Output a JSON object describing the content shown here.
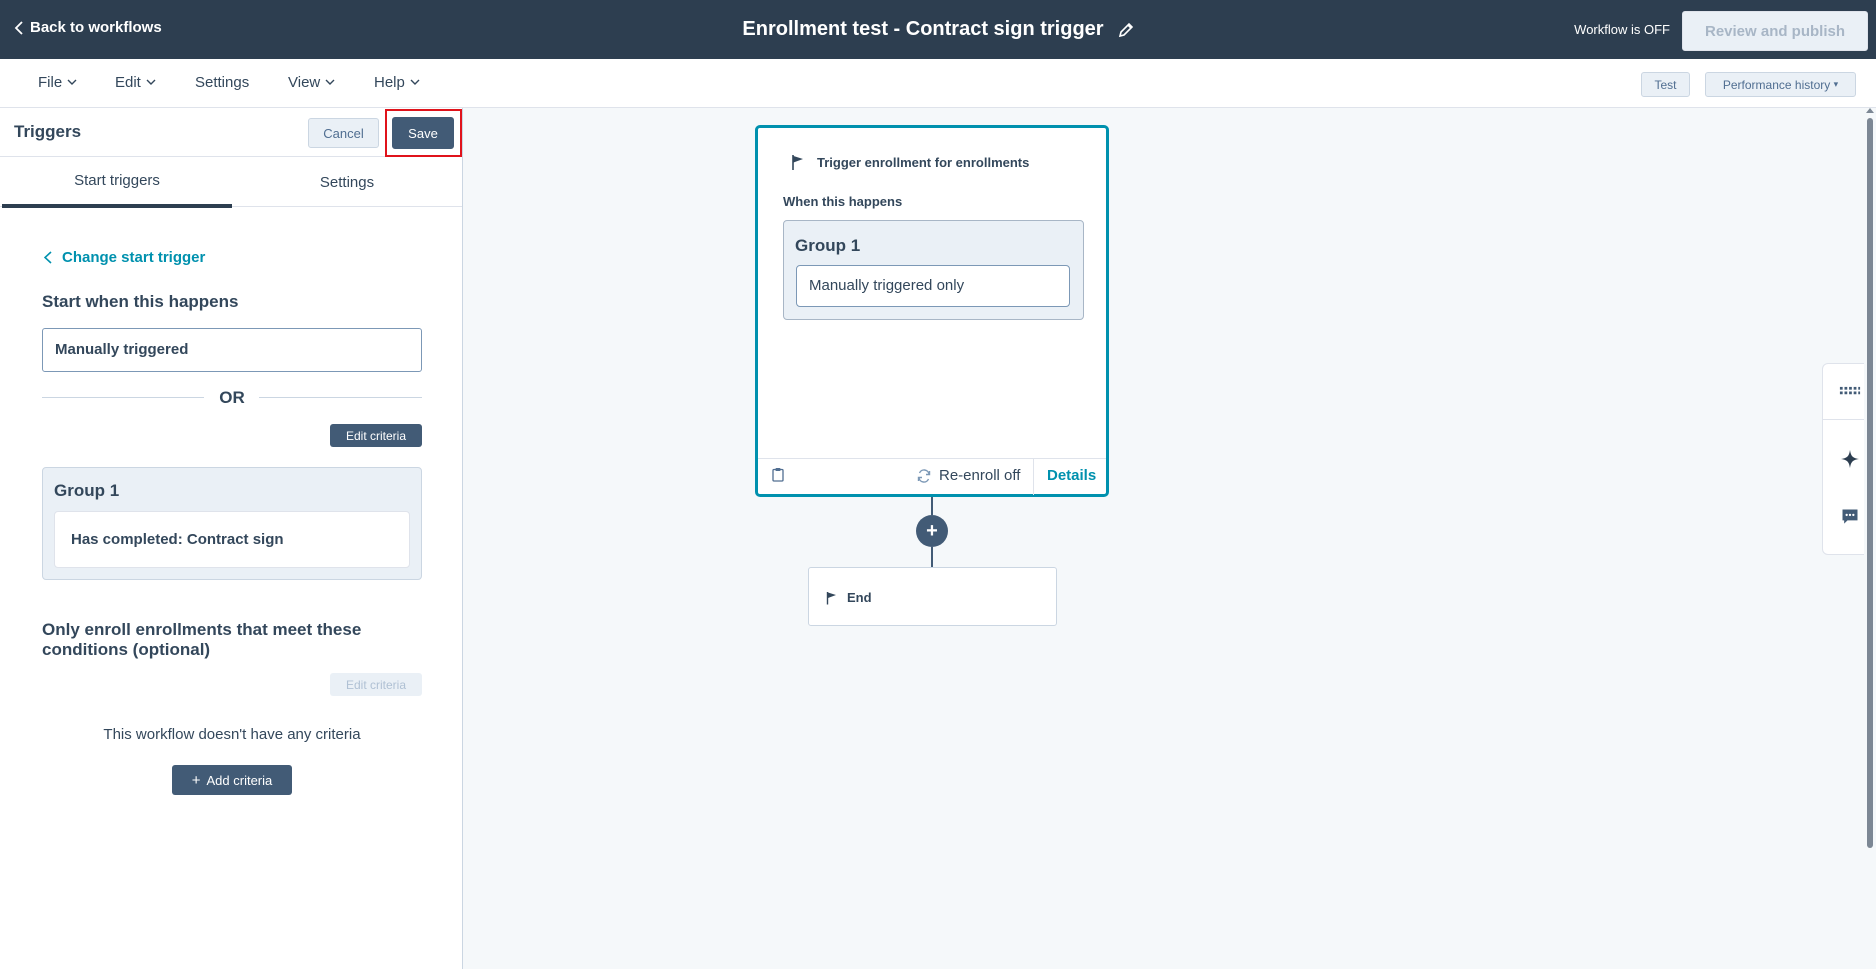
{
  "header": {
    "back_label": "Back to workflows",
    "title": "Enrollment test - Contract sign trigger",
    "status": "Workflow is OFF",
    "publish_label": "Review and publish"
  },
  "menu": {
    "items": [
      "File",
      "Edit",
      "Settings",
      "View",
      "Help"
    ],
    "test_label": "Test",
    "perf_label": "Performance history"
  },
  "panel": {
    "title": "Triggers",
    "cancel_label": "Cancel",
    "save_label": "Save",
    "tabs": [
      "Start triggers",
      "Settings"
    ],
    "change_trigger": "Change start trigger",
    "start_heading": "Start when this happens",
    "trigger_value": "Manually triggered",
    "or_label": "OR",
    "edit_criteria": "Edit criteria",
    "group_label": "Group 1",
    "group_item": "Has completed: Contract sign",
    "optional_heading": "Only enroll enrollments that meet these conditions (optional)",
    "optional_edit": "Edit criteria",
    "no_criteria": "This workflow doesn't have any criteria",
    "add_criteria": "Add criteria"
  },
  "canvas": {
    "trigger_card": {
      "title": "Trigger enrollment for enrollments",
      "when_label": "When this happens",
      "group_label": "Group 1",
      "group_item": "Manually triggered only",
      "reenroll": "Re-enroll off",
      "details": "Details"
    },
    "end_label": "End"
  },
  "colors": {
    "header_bg": "#2d3e50",
    "accent": "#0091ae",
    "primary_btn": "#425b76",
    "highlight": "#e0131b"
  }
}
